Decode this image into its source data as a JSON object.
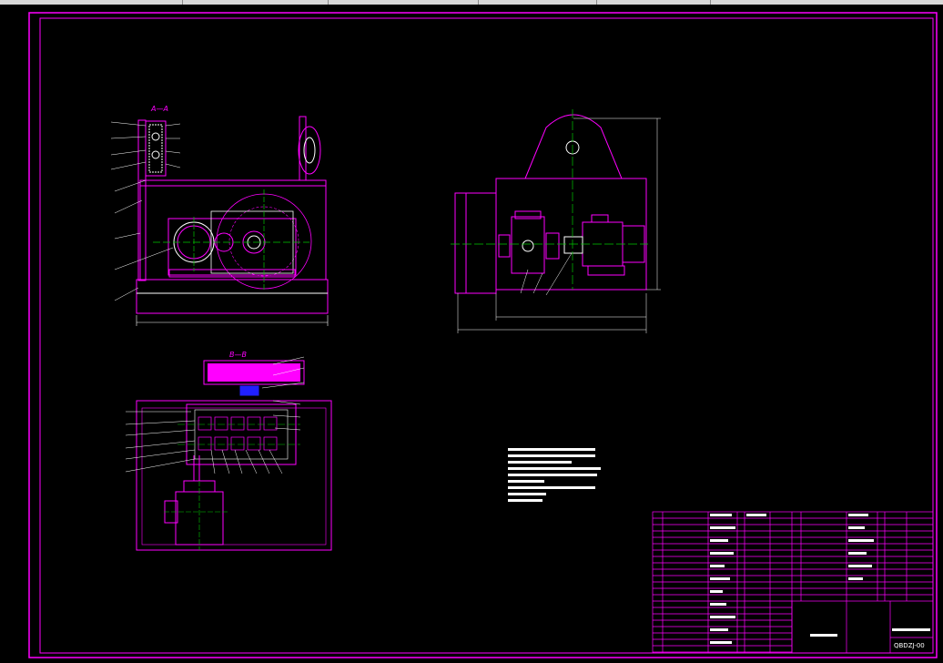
{
  "colors": {
    "background": "#000000",
    "frame": "#ff00ff",
    "outline": "#ffffff",
    "centerline": "#00c800",
    "accent_blue": "#2020ff"
  },
  "views": {
    "section_aa": "A—A",
    "section_bb": "B—B"
  },
  "title_block": {
    "drawing_no": "QBDZJ-00"
  }
}
